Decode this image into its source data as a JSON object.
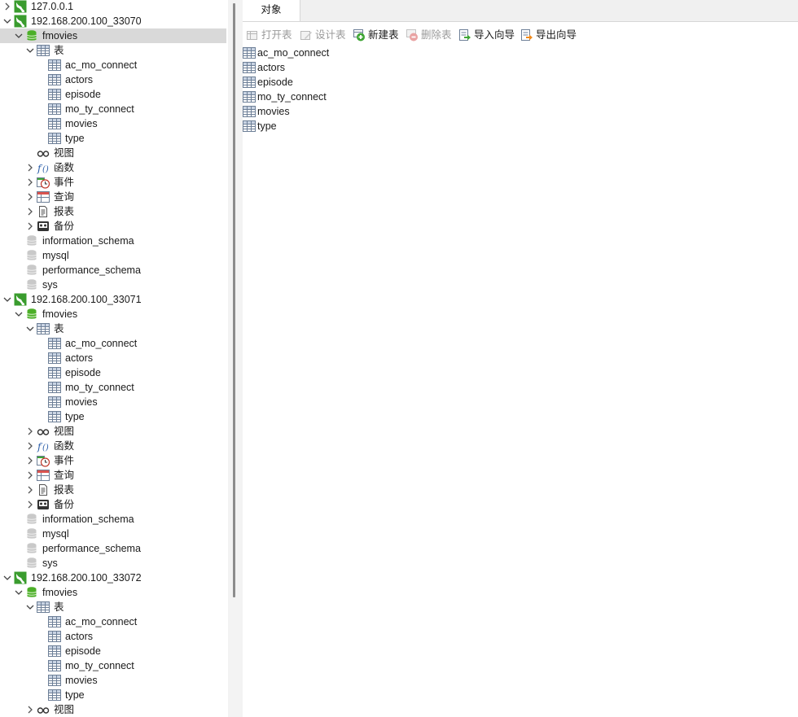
{
  "tree": {
    "nodes": [
      {
        "label": "127.0.0.1",
        "kind": "connection",
        "level": 0,
        "arrow": "collapsed"
      },
      {
        "label": "192.168.200.100_33070",
        "kind": "connection",
        "level": 0,
        "arrow": "expanded"
      },
      {
        "label": "fmovies",
        "kind": "database",
        "level": 1,
        "arrow": "expanded",
        "selected": true
      },
      {
        "label": "表",
        "kind": "tables-folder",
        "level": 2,
        "arrow": "expanded"
      },
      {
        "label": "ac_mo_connect",
        "kind": "table",
        "level": 3,
        "arrow": "none"
      },
      {
        "label": "actors",
        "kind": "table",
        "level": 3,
        "arrow": "none"
      },
      {
        "label": "episode",
        "kind": "table",
        "level": 3,
        "arrow": "none"
      },
      {
        "label": "mo_ty_connect",
        "kind": "table",
        "level": 3,
        "arrow": "none"
      },
      {
        "label": "movies",
        "kind": "table",
        "level": 3,
        "arrow": "none"
      },
      {
        "label": "type",
        "kind": "table",
        "level": 3,
        "arrow": "none"
      },
      {
        "label": "视图",
        "kind": "views",
        "level": 2,
        "arrow": "none"
      },
      {
        "label": "函数",
        "kind": "functions",
        "level": 2,
        "arrow": "collapsed"
      },
      {
        "label": "事件",
        "kind": "events",
        "level": 2,
        "arrow": "collapsed"
      },
      {
        "label": "查询",
        "kind": "queries",
        "level": 2,
        "arrow": "collapsed"
      },
      {
        "label": "报表",
        "kind": "reports",
        "level": 2,
        "arrow": "collapsed"
      },
      {
        "label": "备份",
        "kind": "backups",
        "level": 2,
        "arrow": "collapsed"
      },
      {
        "label": "information_schema",
        "kind": "database-grey",
        "level": 1,
        "arrow": "none"
      },
      {
        "label": "mysql",
        "kind": "database-grey",
        "level": 1,
        "arrow": "none"
      },
      {
        "label": "performance_schema",
        "kind": "database-grey",
        "level": 1,
        "arrow": "none"
      },
      {
        "label": "sys",
        "kind": "database-grey",
        "level": 1,
        "arrow": "none"
      },
      {
        "label": "192.168.200.100_33071",
        "kind": "connection",
        "level": 0,
        "arrow": "expanded"
      },
      {
        "label": "fmovies",
        "kind": "database",
        "level": 1,
        "arrow": "expanded"
      },
      {
        "label": "表",
        "kind": "tables-folder",
        "level": 2,
        "arrow": "expanded"
      },
      {
        "label": "ac_mo_connect",
        "kind": "table",
        "level": 3,
        "arrow": "none"
      },
      {
        "label": "actors",
        "kind": "table",
        "level": 3,
        "arrow": "none"
      },
      {
        "label": "episode",
        "kind": "table",
        "level": 3,
        "arrow": "none"
      },
      {
        "label": "mo_ty_connect",
        "kind": "table",
        "level": 3,
        "arrow": "none"
      },
      {
        "label": "movies",
        "kind": "table",
        "level": 3,
        "arrow": "none"
      },
      {
        "label": "type",
        "kind": "table",
        "level": 3,
        "arrow": "none"
      },
      {
        "label": "视图",
        "kind": "views",
        "level": 2,
        "arrow": "collapsed"
      },
      {
        "label": "函数",
        "kind": "functions",
        "level": 2,
        "arrow": "collapsed"
      },
      {
        "label": "事件",
        "kind": "events",
        "level": 2,
        "arrow": "collapsed"
      },
      {
        "label": "查询",
        "kind": "queries",
        "level": 2,
        "arrow": "collapsed"
      },
      {
        "label": "报表",
        "kind": "reports",
        "level": 2,
        "arrow": "collapsed"
      },
      {
        "label": "备份",
        "kind": "backups",
        "level": 2,
        "arrow": "collapsed"
      },
      {
        "label": "information_schema",
        "kind": "database-grey",
        "level": 1,
        "arrow": "none"
      },
      {
        "label": "mysql",
        "kind": "database-grey",
        "level": 1,
        "arrow": "none"
      },
      {
        "label": "performance_schema",
        "kind": "database-grey",
        "level": 1,
        "arrow": "none"
      },
      {
        "label": "sys",
        "kind": "database-grey",
        "level": 1,
        "arrow": "none"
      },
      {
        "label": "192.168.200.100_33072",
        "kind": "connection",
        "level": 0,
        "arrow": "expanded"
      },
      {
        "label": "fmovies",
        "kind": "database",
        "level": 1,
        "arrow": "expanded"
      },
      {
        "label": "表",
        "kind": "tables-folder",
        "level": 2,
        "arrow": "expanded"
      },
      {
        "label": "ac_mo_connect",
        "kind": "table",
        "level": 3,
        "arrow": "none"
      },
      {
        "label": "actors",
        "kind": "table",
        "level": 3,
        "arrow": "none"
      },
      {
        "label": "episode",
        "kind": "table",
        "level": 3,
        "arrow": "none"
      },
      {
        "label": "mo_ty_connect",
        "kind": "table",
        "level": 3,
        "arrow": "none"
      },
      {
        "label": "movies",
        "kind": "table",
        "level": 3,
        "arrow": "none"
      },
      {
        "label": "type",
        "kind": "table",
        "level": 3,
        "arrow": "none"
      },
      {
        "label": "视图",
        "kind": "views",
        "level": 2,
        "arrow": "collapsed"
      }
    ]
  },
  "tabs": {
    "objects": "对象"
  },
  "toolbar": {
    "open_table": "打开表",
    "design_table": "设计表",
    "new_table": "新建表",
    "delete_table": "删除表",
    "import_wizard": "导入向导",
    "export_wizard": "导出向导"
  },
  "objects": [
    "ac_mo_connect",
    "actors",
    "episode",
    "mo_ty_connect",
    "movies",
    "type"
  ],
  "colors": {
    "selected_row": "#d9d9d9",
    "connection_green": "#3a9c2e",
    "db_green": "#4caf28",
    "disabled_text": "#9a9a9a"
  }
}
